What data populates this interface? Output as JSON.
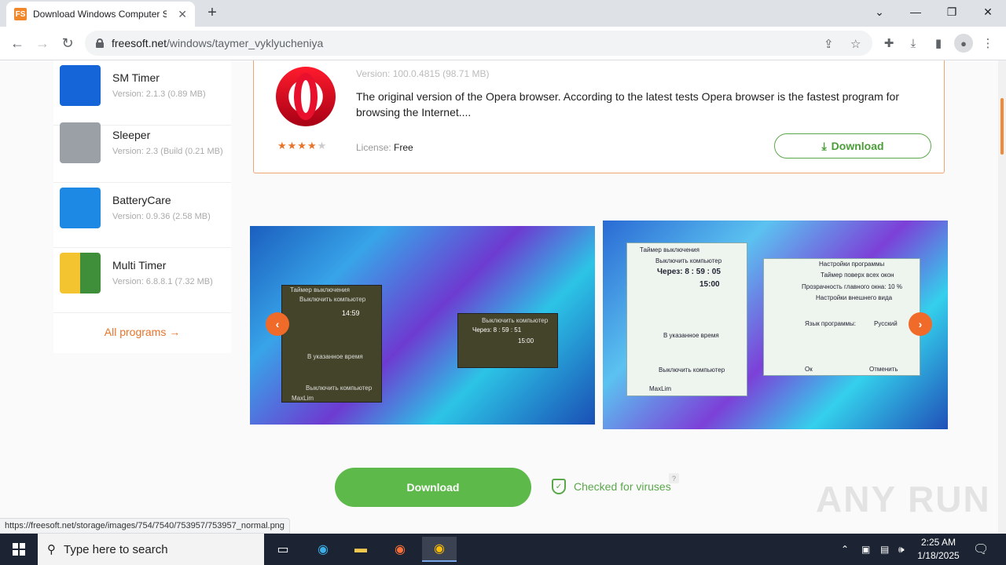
{
  "browser": {
    "tab_title": "Download Windows Computer S",
    "tab_favicon_text": "FS",
    "url_host": "freesoft.net",
    "url_path": "/windows/taymer_vyklyucheniya",
    "status_url": "https://freesoft.net/storage/images/754/7540/753957/753957_normal.png"
  },
  "sidebar": {
    "items": [
      {
        "name": "SM Timer",
        "version": "Version: 2.1.3 (0.89 MB)",
        "icon_color": "#1565d8"
      },
      {
        "name": "Sleeper",
        "version": "Version: 2.3 (Build (0.21 MB)",
        "icon_color": "#888888"
      },
      {
        "name": "BatteryCare",
        "version": "Version: 0.9.36 (2.58 MB)",
        "icon_color": "#1e88e5"
      },
      {
        "name": "Multi Timer",
        "version": "Version: 6.8.8.1 (7.32 MB)",
        "icon_color": "#4caf50"
      }
    ],
    "all_programs": "All programs →"
  },
  "featured": {
    "version": "Version: 100.0.4815 (98.71 MB)",
    "description": "The original version of the Opera browser. According to the latest tests Opera browser is the fastest program for browsing the Internet....",
    "rating_stars": 4,
    "license_label": "License:",
    "license_value": "Free",
    "download_label": "Download"
  },
  "screenshot1": {
    "panel_title": "Таймер выключения",
    "action": "Выключить компьютер",
    "time": "14:59",
    "mode": "В указанное время",
    "footer": "MaxLim",
    "sub_action": "Выключить компьютер",
    "sub_time": "Через: 8 : 59 : 51",
    "sub_clock": "15:00"
  },
  "screenshot2": {
    "panel_title": "Таймер выключения",
    "action": "Выключить компьютер",
    "countdown": "Через: 8 : 59 : 05",
    "time": "15:00",
    "mode": "В указанное время",
    "settings_title": "Настройки программы",
    "opt1": "Таймер поверх всех окон",
    "opt2": "Прозрачность главного окна: 10 %",
    "opt3": "Настройки внешнего вида",
    "opt4": "Язык программы:",
    "lang": "Русский",
    "ok": "Ок",
    "cancel": "Отменить",
    "footer": "MaxLim"
  },
  "main": {
    "download_button": "Download",
    "virus_check": "Checked for viruses",
    "help_mark": "?"
  },
  "watermark": "ANY RUN",
  "taskbar": {
    "search_placeholder": "Type here to search",
    "time": "2:25 AM",
    "date": "1/18/2025"
  },
  "colors": {
    "accent_orange": "#e8742a",
    "accent_green": "#5cb94a",
    "taskbar": "#1c2433"
  }
}
